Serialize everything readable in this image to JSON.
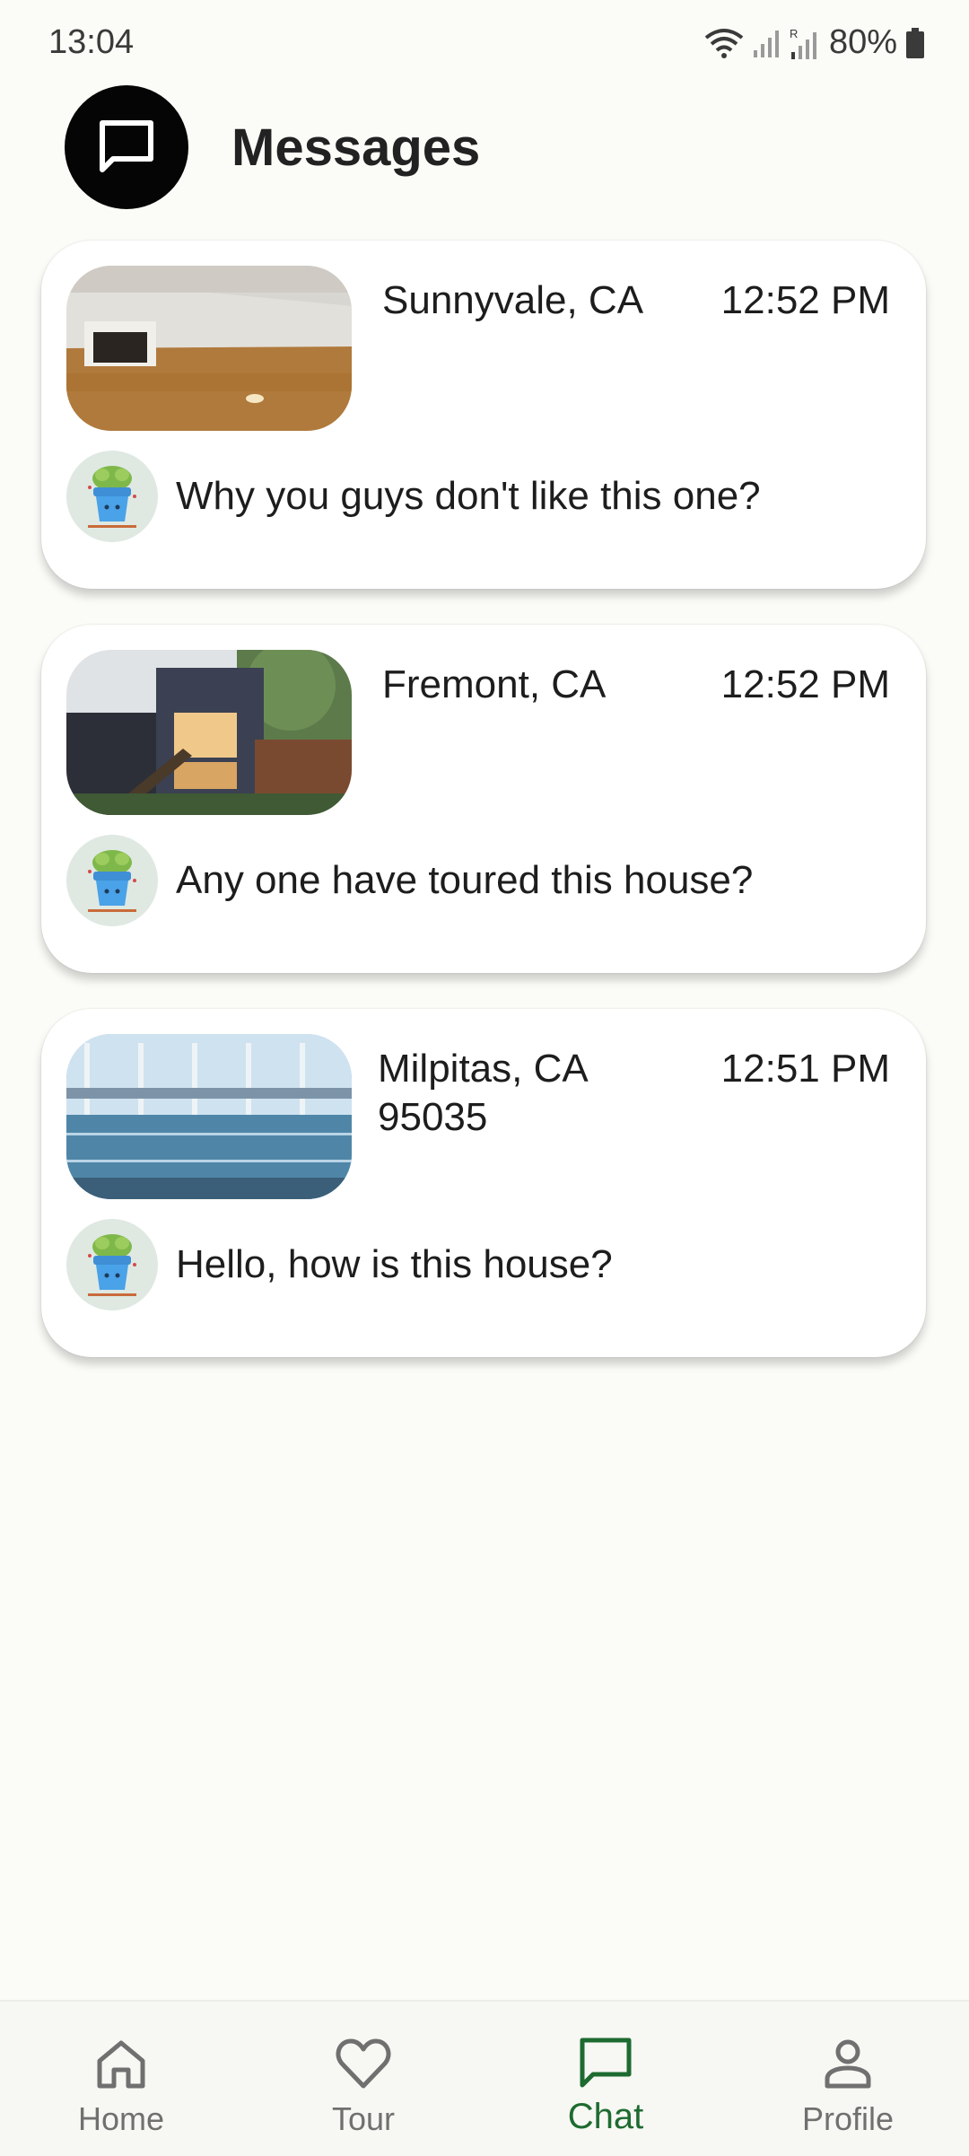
{
  "status_bar": {
    "time": "13:04",
    "battery": "80%",
    "icons": [
      "wifi-icon",
      "signal-icon",
      "signal-roaming-icon",
      "battery-icon"
    ]
  },
  "header": {
    "title": "Messages",
    "icon": "chat-bubble-icon"
  },
  "chats": [
    {
      "location": "Sunnyvale, CA",
      "time": "12:52 PM",
      "message": "Why you guys don't like this one?",
      "photo": "empty-room-photo"
    },
    {
      "location": "Fremont, CA",
      "time": "12:52 PM",
      "message": "Any one have toured this house?",
      "photo": "house-exterior-photo"
    },
    {
      "location": "Milpitas, CA 95035",
      "time": "12:51 PM",
      "message": "Hello, how is this house?",
      "photo": "indoor-pool-photo"
    }
  ],
  "nav": {
    "items": [
      {
        "label": "Home",
        "icon": "home-icon"
      },
      {
        "label": "Tour",
        "icon": "heart-icon"
      },
      {
        "label": "Chat",
        "icon": "chat-icon"
      },
      {
        "label": "Profile",
        "icon": "profile-icon"
      }
    ],
    "active": "Chat",
    "active_color": "#1d6b30"
  }
}
